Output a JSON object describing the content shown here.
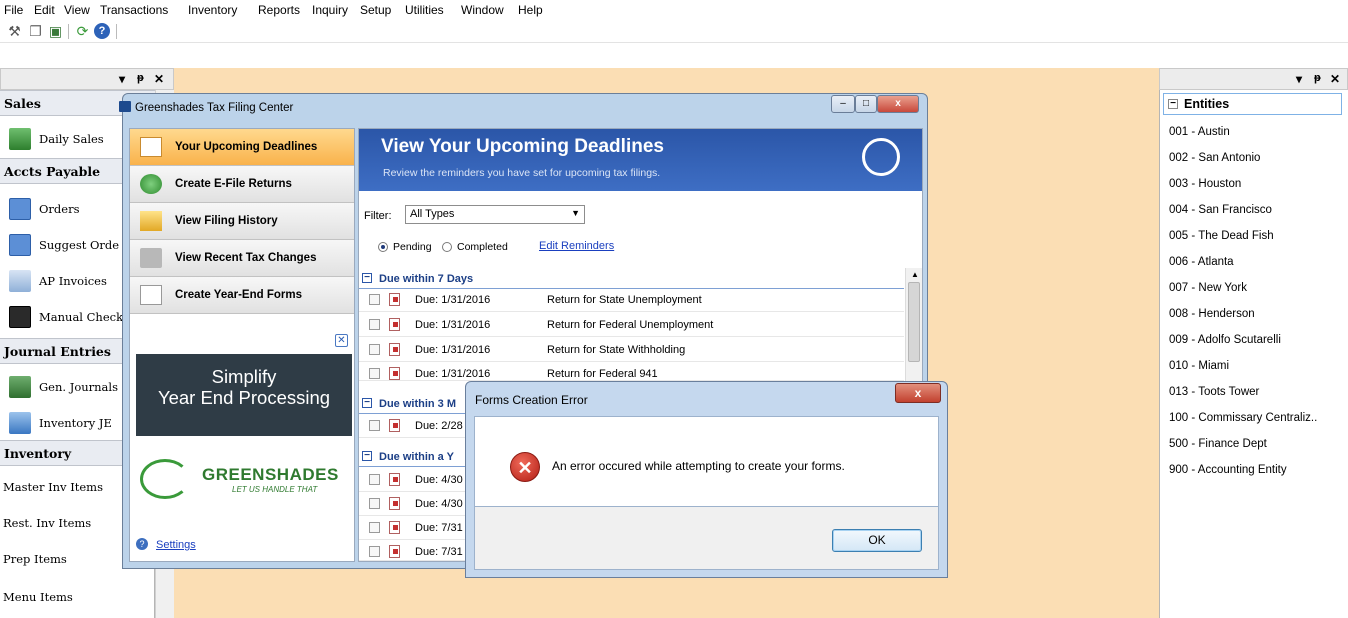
{
  "menubar": {
    "items": [
      "File",
      "Edit",
      "View",
      "Transactions",
      "Inventory",
      "Reports",
      "Inquiry",
      "Setup",
      "Utilities",
      "Window",
      "Help"
    ]
  },
  "toolbar": {
    "icons": [
      "wrench-icon",
      "copy-icon",
      "paste-icon",
      "refresh-icon",
      "help-icon"
    ]
  },
  "pane_buttons": {
    "left": "▾ ⫽ ✕",
    "right": "▾ ⫽ ✕",
    "dropdown": "▾",
    "pin": "ᵽ",
    "close": "✕"
  },
  "left_panel": {
    "sections": [
      {
        "title": "Sales",
        "items": [
          {
            "label": "Daily Sales",
            "icon": "daily-sales-icon"
          }
        ]
      },
      {
        "title": "Accts Payable",
        "items": [
          {
            "label": "Orders",
            "icon": "orders-icon"
          },
          {
            "label": "Suggest Orde",
            "icon": "suggest-orders-icon"
          },
          {
            "label": "AP Invoices",
            "icon": "ap-invoices-icon"
          },
          {
            "label": "Manual Check",
            "icon": "manual-check-icon"
          }
        ]
      },
      {
        "title": "Journal Entries",
        "items": [
          {
            "label": "Gen. Journals",
            "icon": "gen-journals-icon"
          },
          {
            "label": "Inventory JE",
            "icon": "inventory-je-icon"
          }
        ]
      },
      {
        "title": "Inventory",
        "items": [
          {
            "label": "Master Inv Items",
            "icon": ""
          },
          {
            "label": "Rest. Inv Items",
            "icon": ""
          },
          {
            "label": "Prep Items",
            "icon": ""
          },
          {
            "label": "Menu Items",
            "icon": ""
          }
        ]
      }
    ]
  },
  "right_panel": {
    "header": "Entities",
    "collapse_glyph": "−",
    "entities": [
      "001 - Austin",
      "002 - San Antonio",
      "003 - Houston",
      "004 - San Francisco",
      "005 - The Dead Fish",
      "006 - Atlanta",
      "007 - New York",
      "008 - Henderson",
      "009 - Adolfo Scutarelli",
      "010 - Miami",
      "013 - Toots Tower",
      "100 - Commissary Centraliz..",
      "500 - Finance Dept",
      "900 - Accounting Entity"
    ]
  },
  "tax_window": {
    "title": "Greenshades Tax Filing Center",
    "nav": [
      "Your Upcoming Deadlines",
      "Create E-File Returns",
      "View Filing History",
      "View Recent Tax Changes",
      "Create Year-End Forms"
    ],
    "ad_close": "✕",
    "ad_banner_line1": "Simplify",
    "ad_banner_line2": "Year End Processing",
    "logo_name": "GREENSHADES",
    "logo_tagline": "LET US HANDLE THAT",
    "settings_label": "Settings",
    "settings_icon_glyph": "?",
    "header_title": "View Your Upcoming Deadlines",
    "header_subtitle": "Review the reminders you have set for upcoming tax filings.",
    "filter_label": "Filter:",
    "filter_value": "All Types",
    "radio_pending": "Pending",
    "radio_completed": "Completed",
    "edit_reminders": "Edit Reminders",
    "groups": [
      {
        "label": "Due within 7 Days",
        "rows": [
          {
            "due": "Due: 1/31/2016",
            "desc": "Return for State Unemployment"
          },
          {
            "due": "Due: 1/31/2016",
            "desc": "Return for Federal Unemployment"
          },
          {
            "due": "Due: 1/31/2016",
            "desc": "Return for State Withholding"
          },
          {
            "due": "Due: 1/31/2016",
            "desc": "Return for Federal 941"
          }
        ]
      },
      {
        "label": "Due within 3 M",
        "rows": [
          {
            "due": "Due: 2/28",
            "desc": ""
          }
        ]
      },
      {
        "label": "Due within a Y",
        "rows": [
          {
            "due": "Due: 4/30",
            "desc": ""
          },
          {
            "due": "Due: 4/30",
            "desc": ""
          },
          {
            "due": "Due: 7/31",
            "desc": ""
          },
          {
            "due": "Due: 7/31",
            "desc": ""
          }
        ]
      }
    ]
  },
  "error_dialog": {
    "title": "Forms Creation Error",
    "close_glyph": "x",
    "icon_glyph": "✕",
    "message": "An error occured while attempting to create your forms.",
    "ok_label": "OK"
  },
  "colors": {
    "desktop": "#fbdeb4",
    "nav_active": "#f9b24b",
    "header_blue": "#2b56a8"
  }
}
